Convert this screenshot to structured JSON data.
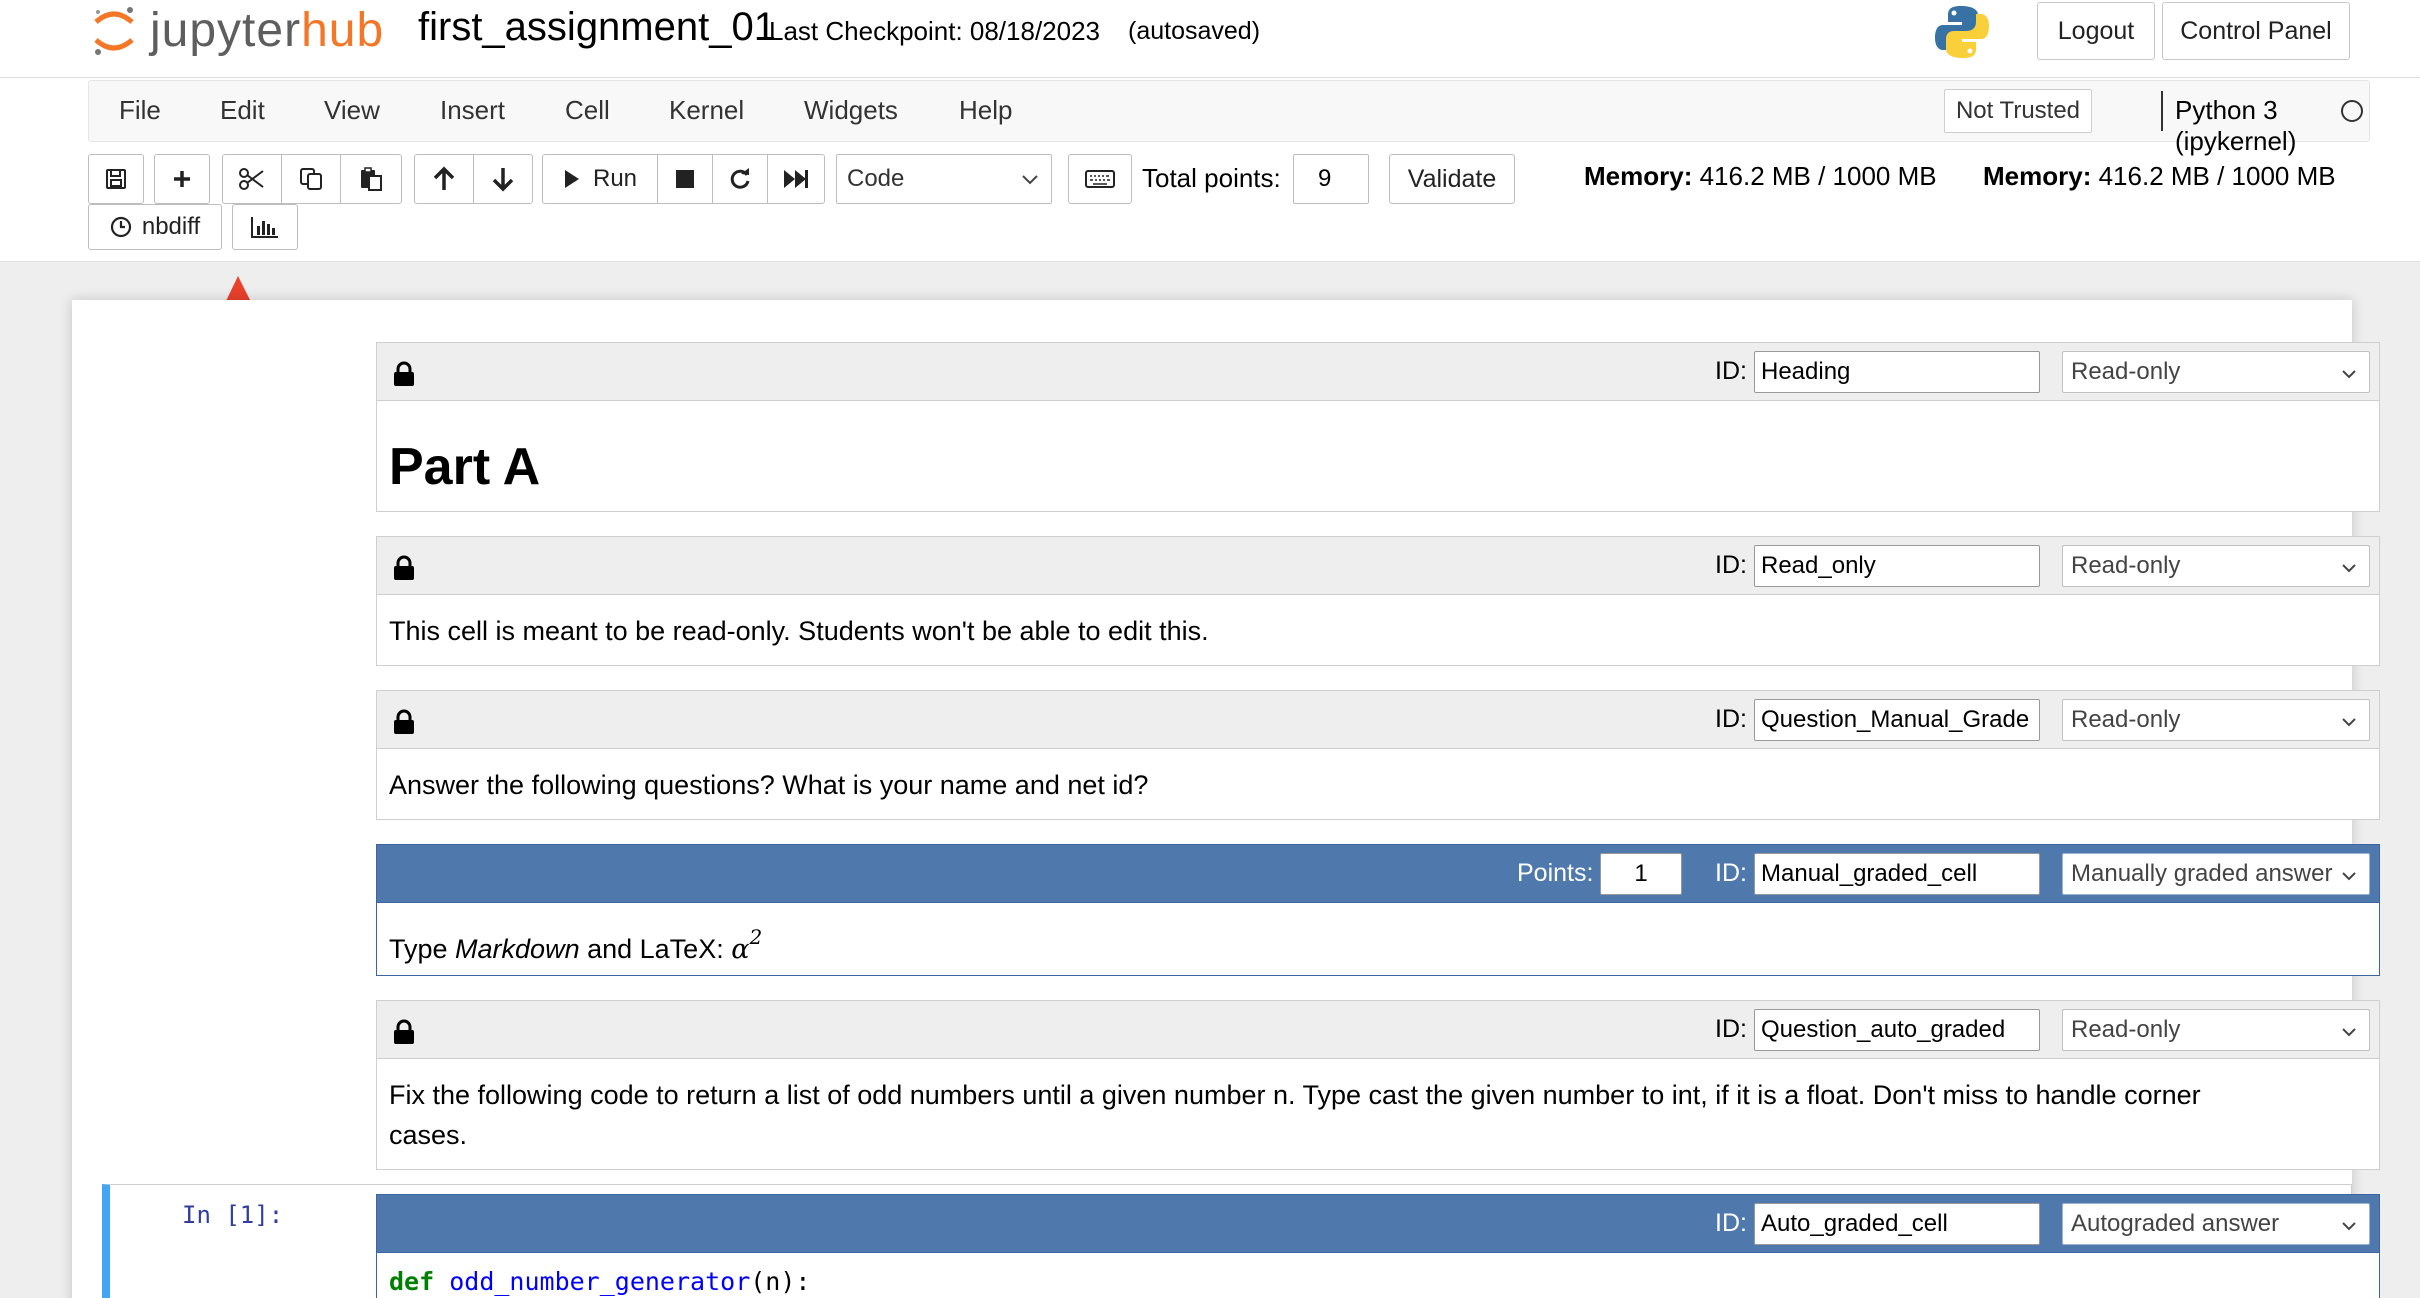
{
  "header": {
    "logo_word_1": "jupyter",
    "logo_word_2": "hub",
    "notebook_name": "first_assignment_01",
    "checkpoint": "Last Checkpoint: 08/18/2023",
    "autosave": "(autosaved)",
    "logout": "Logout",
    "control_panel": "Control Panel",
    "icons": {
      "logo": "jupyter-logo-icon",
      "python": "python-logo-icon"
    }
  },
  "menubar": {
    "items": [
      "File",
      "Edit",
      "View",
      "Insert",
      "Cell",
      "Kernel",
      "Widgets",
      "Help"
    ],
    "trusted": "Not Trusted",
    "kernel": "Python 3 (ipykernel)"
  },
  "toolbar": {
    "run_label": "Run",
    "cell_type": "Code",
    "total_points_label": "Total points:",
    "total_points_value": "9",
    "validate": "Validate",
    "nbdiff": "nbdiff",
    "memory_label": "Memory:",
    "memory_value": "416.2 MB / 1000 MB",
    "icons": [
      "save-icon",
      "plus-icon",
      "scissors-icon",
      "copy-icon",
      "paste-icon",
      "arrow-up-icon",
      "arrow-down-icon",
      "play-icon",
      "stop-icon",
      "restart-icon",
      "fast-forward-icon",
      "keyboard-icon",
      "clock-icon",
      "bar-chart-icon"
    ]
  },
  "cells": [
    {
      "id_label": "ID:",
      "id": "Heading",
      "role": "Read-only",
      "heading": "Part A"
    },
    {
      "id_label": "ID:",
      "id": "Read_only",
      "role": "Read-only",
      "text": "This cell is meant to be read-only. Students won't be able to edit this."
    },
    {
      "id_label": "ID:",
      "id": "Question_Manual_Grade",
      "role": "Read-only",
      "text": "Answer the following questions? What is your name and net id?"
    },
    {
      "id_label": "ID:",
      "points_label": "Points:",
      "points": "1",
      "id": "Manual_graded_cell",
      "role": "Manually graded answer",
      "text_type": "Type ",
      "text_markdown": "Markdown",
      "text_and": " and LaTeX: ",
      "text_alpha": "α",
      "text_sup": "2"
    },
    {
      "id_label": "ID:",
      "id": "Question_auto_graded",
      "role": "Read-only",
      "text_line1": "Fix the following code to return a list of odd numbers until a given number n. Type cast the given number to int, if it is a float. Don't miss to handle corner",
      "text_line2": "cases."
    },
    {
      "id_label": "ID:",
      "id": "Auto_graded_cell",
      "role": "Autograded answer",
      "prompt": "In [1]:",
      "code_def": "def",
      "code_fn": "odd_number_generator",
      "code_args": "(n):"
    }
  ],
  "colors": {
    "accent": "#4f79ad",
    "logo_orange": "#f37726",
    "annotation_arrow": "#e8412c"
  }
}
